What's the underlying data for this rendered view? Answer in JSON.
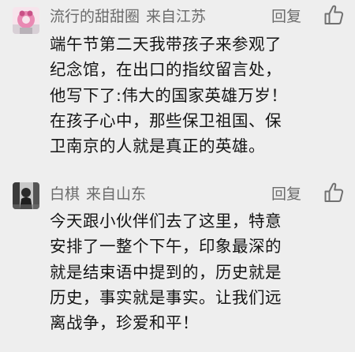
{
  "comments": [
    {
      "username": "流行的甜甜圈",
      "location": "来自江苏",
      "reply_label": "回复",
      "avatar_icon": "avatar-pink-girl",
      "like_icon": "thumbs-up-icon",
      "lines": [
        "端午节第二天我带孩子来参观了",
        "纪念馆，在出口的指纹留言处，",
        "他写下了:伟大的国家英雄万岁！",
        "在孩子心中，那些保卫祖国、保",
        "卫南京的人就是真正的英雄。"
      ]
    },
    {
      "username": "白棋",
      "location": "来自山东",
      "reply_label": "回复",
      "avatar_icon": "avatar-dark-portrait",
      "like_icon": "thumbs-up-icon",
      "lines": [
        "今天跟小伙伴们去了这里，特意",
        "安排了一整个下午，印象最深的",
        "就是结束语中提到的，历史就是",
        "历史，事实就是事实。让我们远",
        "离战争，珍爱和平！"
      ]
    }
  ],
  "colors": {
    "background": "#eeeeee",
    "meta_text": "#6b6b6b",
    "body_text": "#141414",
    "icon_stroke": "#707070"
  }
}
